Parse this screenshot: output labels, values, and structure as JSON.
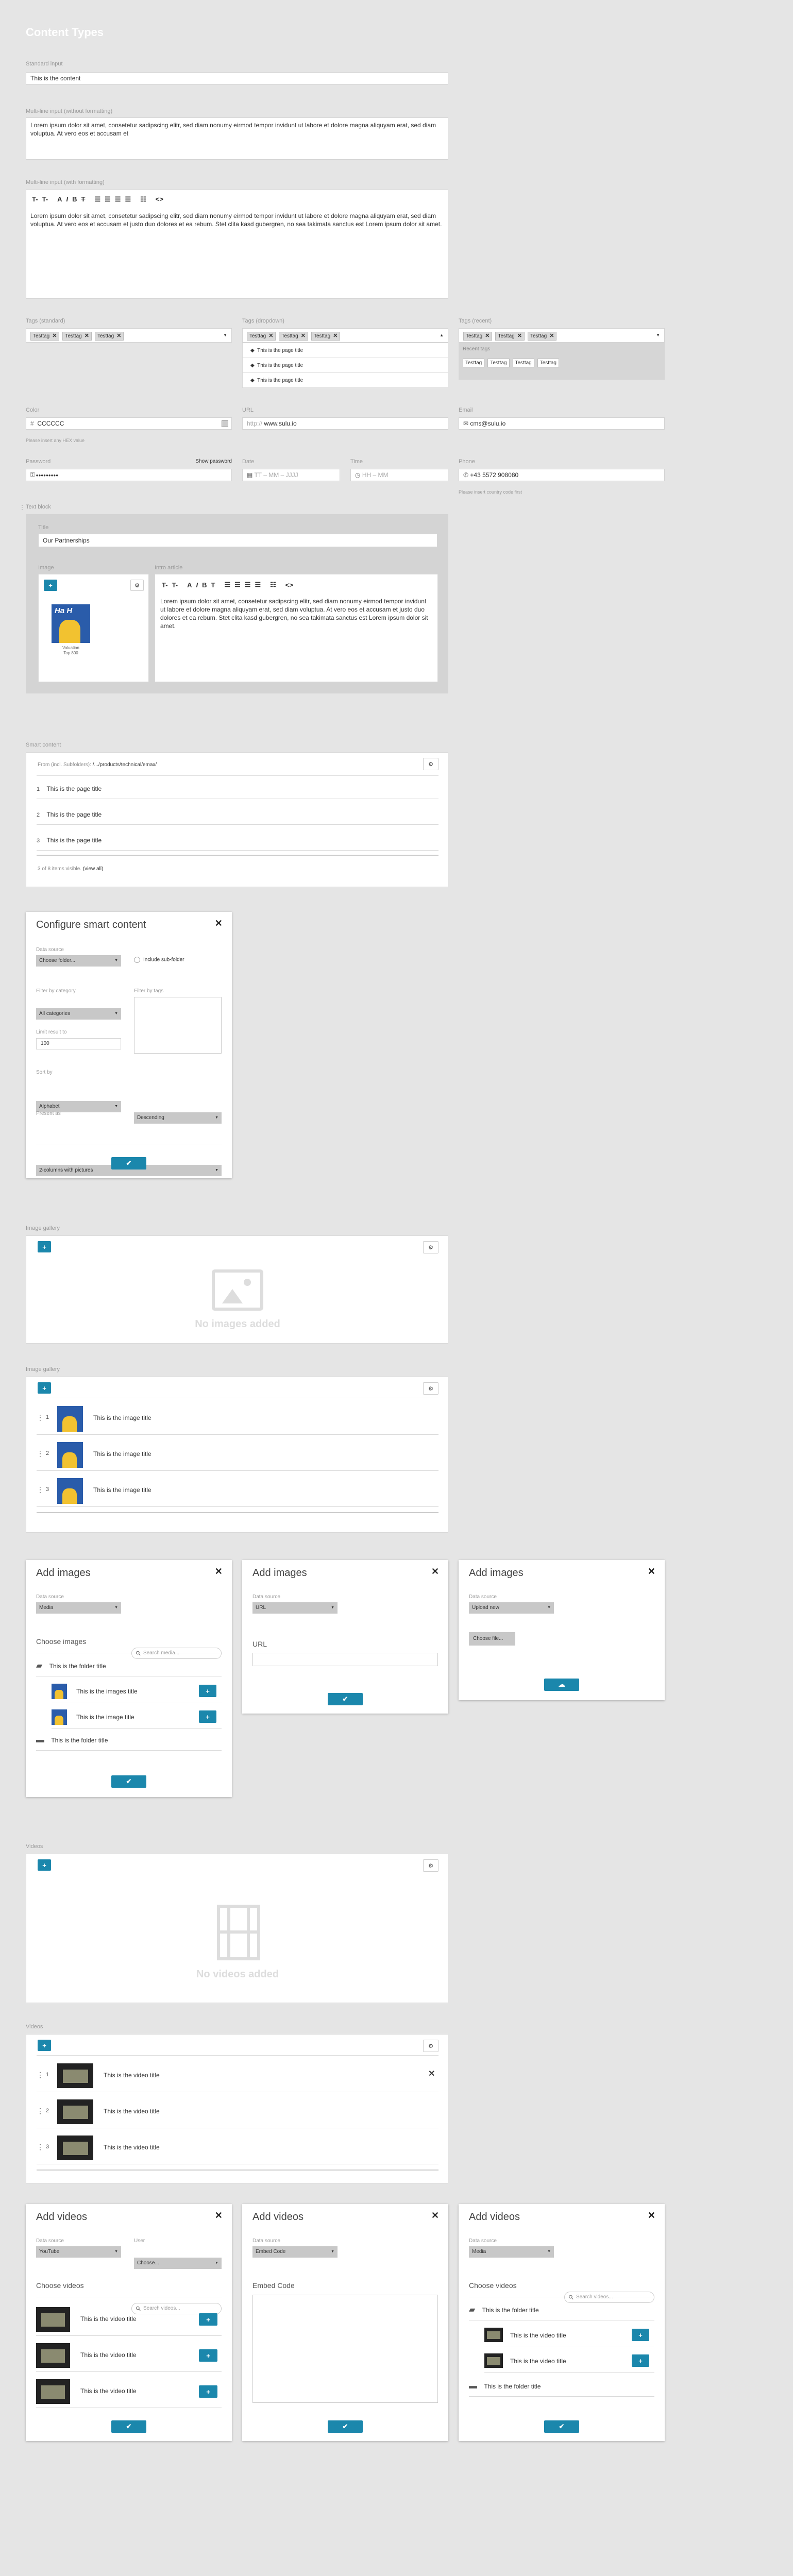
{
  "page_title": "Content Types",
  "standard": {
    "label": "Standard input",
    "value": "This is the content"
  },
  "ml1": {
    "label": "Multi-line input (without formatting)",
    "value": "Lorem ipsum dolor sit amet, consetetur sadipscing elitr, sed diam nonumy eirmod tempor invidunt ut labore et dolore magna aliquyam erat, sed diam voluptua. At vero eos et accusam et"
  },
  "ml2": {
    "label": "Multi-line input (with formatting)",
    "value": "Lorem ipsum dolor sit amet, consetetur sadipscing elitr, sed diam nonumy eirmod tempor invidunt ut labore et dolore magna aliquyam erat, sed diam voluptua. At vero eos et accusam et justo duo dolores et ea rebum. Stet clita kasd gubergren, no sea takimata sanctus est Lorem ipsum dolor sit amet."
  },
  "toolbar": {
    "t1": "T-",
    "t2": "T-",
    "font": "A",
    "italic": "I",
    "bold": "B",
    "strike": "T",
    "code": "<>"
  },
  "tags_std": {
    "label": "Tags (standard)",
    "tags": [
      "Testtag",
      "Testtag",
      "Testtag"
    ]
  },
  "tags_drop": {
    "label": "Tags (dropdown)",
    "tags": [
      "Testtag",
      "Testtag",
      "Testtag"
    ],
    "options": [
      "This is the page title",
      "This is the page title",
      "This is the page title"
    ]
  },
  "tags_recent": {
    "label": "Tags (recent)",
    "tags": [
      "Testtag",
      "Testtag",
      "Testtag"
    ],
    "recent_label": "Recent tags",
    "recent": [
      "Testtag",
      "Testtag",
      "Testtag",
      "Testtag"
    ]
  },
  "color": {
    "label": "Color",
    "prefix": "#",
    "value": "CCCCCC",
    "hint": "Please insert any HEX value"
  },
  "url": {
    "label": "URL",
    "prefix": "http://",
    "value": "www.sulu.io"
  },
  "email": {
    "label": "Email",
    "value": "cms@sulu.io"
  },
  "password": {
    "label": "Password",
    "show": "Show password",
    "value": "●●●●●●●●●"
  },
  "date": {
    "label": "Date",
    "value": "TT – MM – JJJJ"
  },
  "time": {
    "label": "Time",
    "value": "HH – MM"
  },
  "phone": {
    "label": "Phone",
    "value": "+43 5572 908080",
    "hint": "Please insert country code first"
  },
  "textblock": {
    "label": "Text block",
    "title_label": "Title",
    "title": "Our Partnerships",
    "image_label": "Image",
    "intro_label": "Intro article",
    "intro": "Lorem ipsum dolor sit amet, consetetur sadipscing elitr, sed diam nonumy eirmod tempor invidunt ut labore et dolore magna aliquyam erat, sed diam voluptua. At vero eos et accusam et justo duo dolores et ea rebum. Stet clita kasd gubergren, no sea takimata sanctus est Lorem ipsum dolor sit amet.",
    "img_caption1": "Valuation",
    "img_caption2": "Top 800",
    "img_text": "Ha H"
  },
  "smart": {
    "label": "Smart content",
    "from": "From (incl. Subfolders):",
    "path": "/.../products/technical/emax/",
    "items": [
      "This is the page title",
      "This is the page title",
      "This is the page title"
    ],
    "footer": "3 of 8 items visible.",
    "view_all": "(view all)"
  },
  "config": {
    "title": "Configure smart content",
    "ds_label": "Data source",
    "ds": "Choose folder...",
    "subfolder": "Include sub-folder",
    "cat_label": "Filter by category",
    "cat": "All categories",
    "tags_label": "Filter by tags",
    "limit_label": "Limit result to",
    "limit": "100",
    "sort_label": "Sort by",
    "sort": "Alphabet",
    "order": "Descending",
    "present_label": "Present as",
    "present": "2-columns with pictures"
  },
  "gallery_empty": {
    "label": "Image gallery",
    "empty": "No images added"
  },
  "gallery": {
    "label": "Image gallery",
    "items": [
      "This is the image title",
      "This is the image title",
      "This is the image title"
    ]
  },
  "add_images": {
    "title": "Add images",
    "ds_label": "Data source",
    "media": "Media",
    "choose": "Choose images",
    "search": "Search media...",
    "folder": "This is the folder title",
    "images": [
      "This is the images title",
      "This is the image title"
    ],
    "folder2": "This is the folder title",
    "url_ds": "URL",
    "url_label": "URL",
    "upload_ds": "Upload new",
    "choose_file": "Choose file..."
  },
  "videos_empty": {
    "label": "Videos",
    "empty": "No videos added"
  },
  "videos": {
    "label": "Videos",
    "items": [
      "This is the video title",
      "This is the video title",
      "This is the video title"
    ]
  },
  "add_videos": {
    "title": "Add videos",
    "ds_label": "Data source",
    "user_label": "User",
    "youtube": "YouTube",
    "user": "Choose...",
    "choose": "Choose videos",
    "search": "Search videos...",
    "items": [
      "This is the video title",
      "This is the video title",
      "This is the video title"
    ],
    "embed_ds": "Embed Code",
    "embed_label": "Embed Code",
    "media": "Media",
    "folder": "This is the folder title",
    "media_items": [
      "This is the video title",
      "This is the video title"
    ],
    "folder2": "This is the folder title"
  },
  "numbers": [
    "1",
    "2",
    "3"
  ],
  "colors": {
    "accent": "#1b87ac",
    "bg": "#e5e5e5"
  }
}
